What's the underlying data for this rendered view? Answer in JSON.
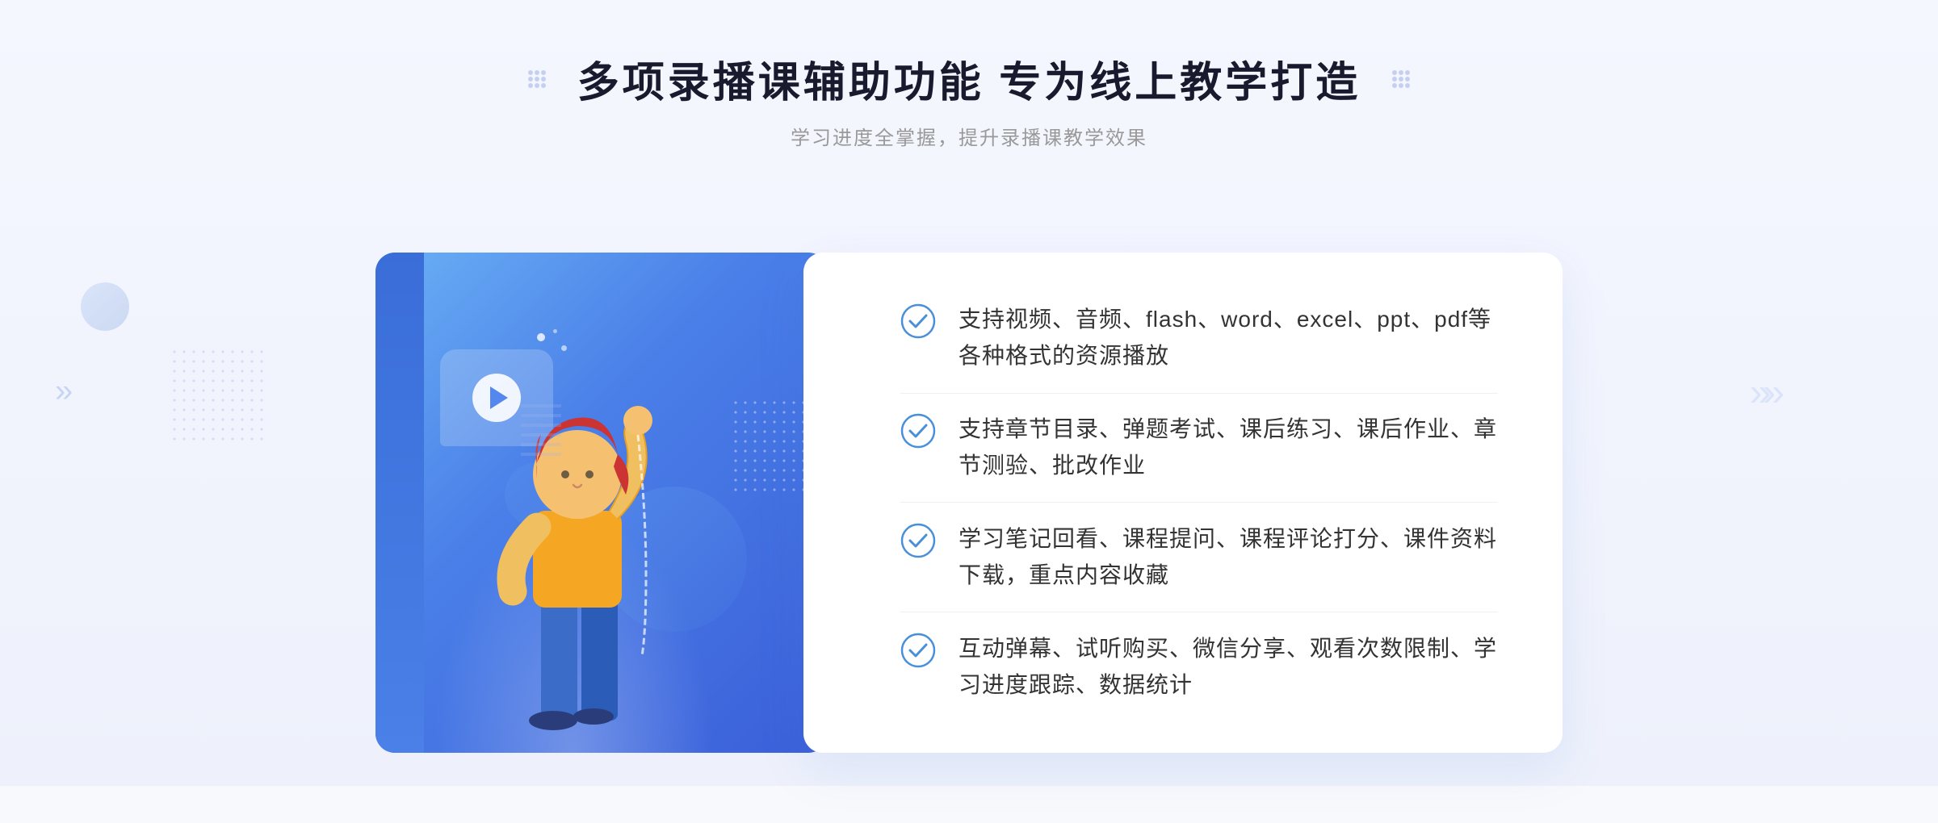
{
  "page": {
    "background_color": "#f5f7fb"
  },
  "header": {
    "main_title": "多项录播课辅助功能 专为线上教学打造",
    "sub_title": "学习进度全掌握，提升录播课教学效果",
    "decorator_label": "decorator-dots"
  },
  "features": [
    {
      "id": 1,
      "text": "支持视频、音频、flash、word、excel、ppt、pdf等各种格式的资源播放"
    },
    {
      "id": 2,
      "text": "支持章节目录、弹题考试、课后练习、课后作业、章节测验、批改作业"
    },
    {
      "id": 3,
      "text": "学习笔记回看、课程提问、课程评论打分、课件资料下载，重点内容收藏"
    },
    {
      "id": 4,
      "text": "互动弹幕、试听购买、微信分享、观看次数限制、学习进度跟踪、数据统计"
    }
  ],
  "colors": {
    "primary_blue": "#4a7fe8",
    "dark_blue": "#3b5fd9",
    "light_blue": "#6ab0f5",
    "check_blue": "#4a90d9",
    "text_dark": "#333333",
    "text_gray": "#999999"
  },
  "icons": {
    "check": "check-circle-icon",
    "play": "play-icon",
    "chevron_left": "«",
    "chevron_right": "»"
  }
}
